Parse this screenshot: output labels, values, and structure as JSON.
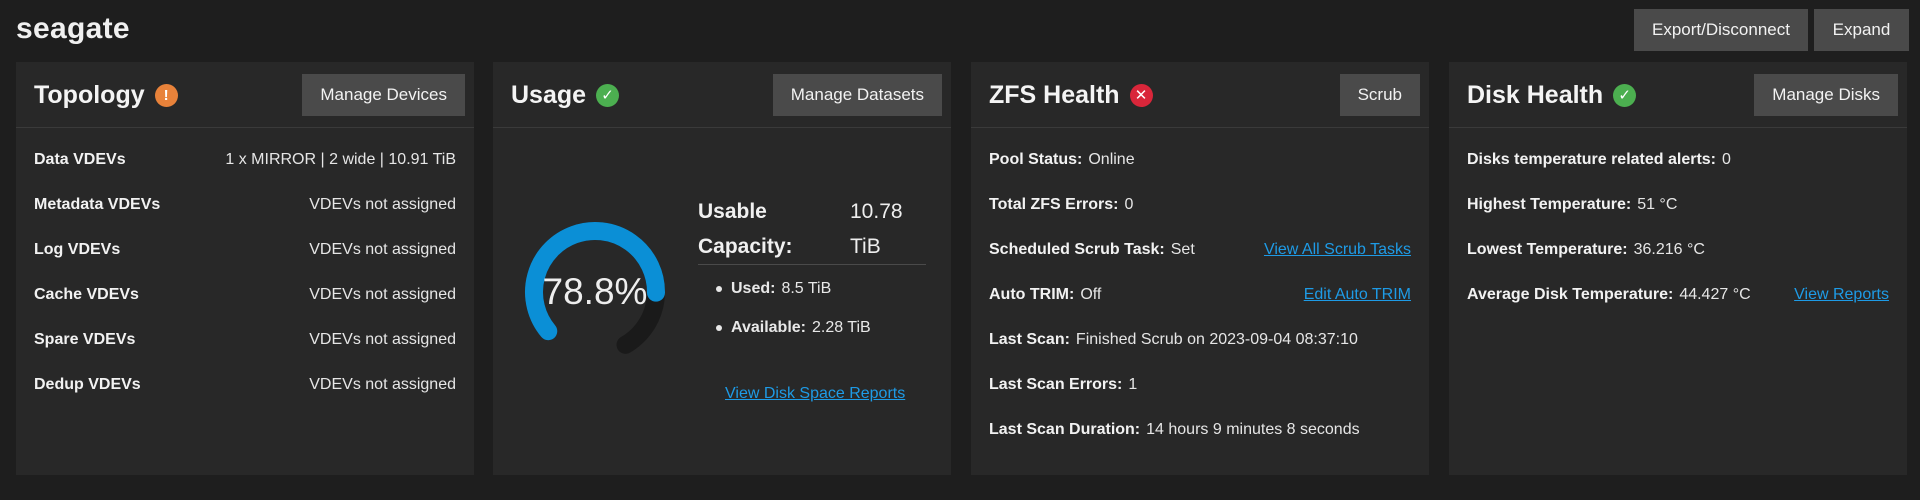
{
  "pool": {
    "name": "seagate",
    "export_label": "Export/Disconnect",
    "expand_label": "Expand"
  },
  "topology": {
    "title": "Topology",
    "status": "warning",
    "button_label": "Manage Devices",
    "rows": [
      {
        "label": "Data VDEVs",
        "value": "1 x MIRROR | 2 wide | 10.91 TiB"
      },
      {
        "label": "Metadata VDEVs",
        "value": "VDEVs not assigned"
      },
      {
        "label": "Log VDEVs",
        "value": "VDEVs not assigned"
      },
      {
        "label": "Cache VDEVs",
        "value": "VDEVs not assigned"
      },
      {
        "label": "Spare VDEVs",
        "value": "VDEVs not assigned"
      },
      {
        "label": "Dedup VDEVs",
        "value": "VDEVs not assigned"
      }
    ]
  },
  "usage": {
    "title": "Usage",
    "status": "ok",
    "button_label": "Manage Datasets",
    "percent_text": "78.8%",
    "percent_used": 0.788,
    "capacity_label_line1": "Usable",
    "capacity_label_line2": "Capacity:",
    "capacity_value_line1": "10.78",
    "capacity_value_line2": "TiB",
    "used_label": "Used:",
    "used_value": "8.5 TiB",
    "available_label": "Available:",
    "available_value": "2.28 TiB",
    "reports_link": "View Disk Space Reports"
  },
  "zfs_health": {
    "title": "ZFS Health",
    "status": "error",
    "button_label": "Scrub",
    "rows": [
      {
        "label": "Pool Status:",
        "value": "Online",
        "link": ""
      },
      {
        "label": "Total ZFS Errors:",
        "value": "0",
        "link": ""
      },
      {
        "label": "Scheduled Scrub Task:",
        "value": "Set",
        "link": "View All Scrub Tasks"
      },
      {
        "label": "Auto TRIM:",
        "value": "Off",
        "link": "Edit Auto TRIM"
      },
      {
        "label": "Last Scan:",
        "value": "Finished Scrub on 2023-09-04 08:37:10",
        "link": ""
      },
      {
        "label": "Last Scan Errors:",
        "value": "1",
        "link": ""
      },
      {
        "label": "Last Scan Duration:",
        "value": "14 hours 9 minutes 8 seconds",
        "link": ""
      }
    ]
  },
  "disk_health": {
    "title": "Disk Health",
    "status": "ok",
    "button_label": "Manage Disks",
    "rows": [
      {
        "label": "Disks temperature related alerts:",
        "value": "0",
        "link": ""
      },
      {
        "label": "Highest Temperature:",
        "value": "51 °C",
        "link": ""
      },
      {
        "label": "Lowest Temperature:",
        "value": "36.216 °C",
        "link": ""
      },
      {
        "label": "Average Disk Temperature:",
        "value": "44.427 °C",
        "link": "View Reports"
      }
    ]
  },
  "colors": {
    "accent_blue": "#0b8fd6",
    "link_blue": "#1e9be6",
    "ok_green": "#4caf50",
    "warning_orange": "#e8823a",
    "error_red": "#d9263a",
    "gauge_track": "#1a1a1a"
  },
  "icons": {
    "warning": "exclamation-circle-icon",
    "ok": "check-circle-icon",
    "error": "x-circle-icon"
  }
}
